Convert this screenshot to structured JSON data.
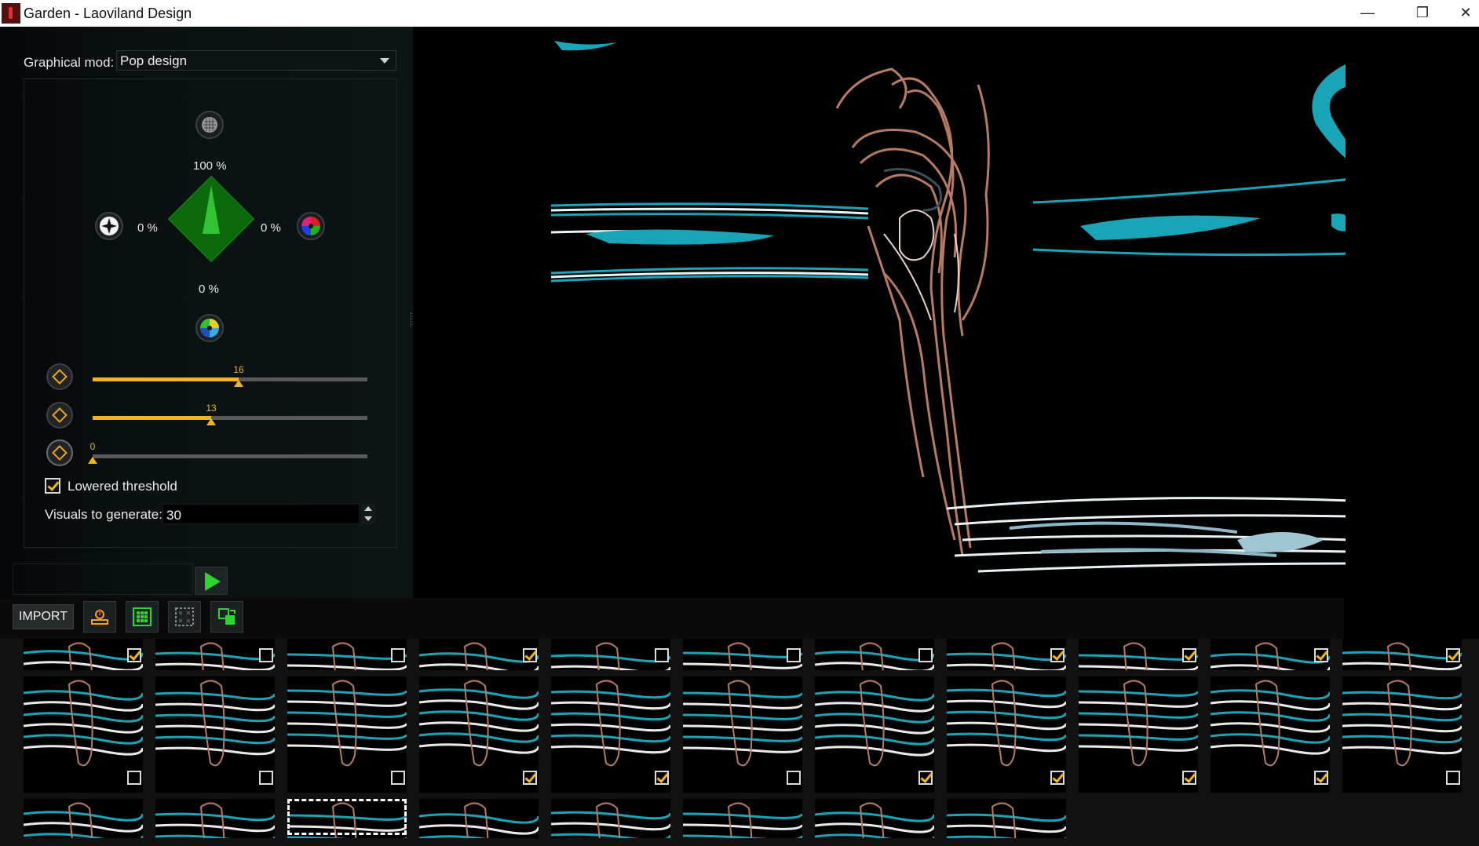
{
  "window": {
    "title": "Garden - Laoviland Design",
    "minimize_glyph": "—",
    "maximize_glyph": "❐",
    "close_glyph": "✕"
  },
  "controls": {
    "graphical_mod_label": "Graphical mod:",
    "graphical_mod_value": "Pop design",
    "top_pct": "100 %",
    "left_pct": "0 %",
    "right_pct": "0 %",
    "bottom_pct": "0 %",
    "icons": {
      "top": "texture-circle-icon",
      "left": "black-white-compass-icon",
      "right": "rgb-color-wheel-icon",
      "bottom": "cmy-color-wheel-icon",
      "slider1": "layers-icon",
      "slider2": "fire-layers-icon",
      "slider3": "contrast-icon"
    },
    "sliders": [
      {
        "value": "16",
        "fraction": 0.53
      },
      {
        "value": "13",
        "fraction": 0.43
      },
      {
        "value": "0",
        "fraction": 0.0
      }
    ],
    "lowered_threshold_label": "Lowered threshold",
    "lowered_threshold_checked": true,
    "visuals_label": "Visuals to generate:",
    "visuals_value": "30"
  },
  "toolbar": {
    "import_label": "IMPORT",
    "buttons": [
      "export-icon",
      "select-all-icon",
      "select-none-icon",
      "swap-icon"
    ]
  },
  "gallery": {
    "rows": [
      [
        true,
        false,
        false,
        true,
        false,
        false,
        false,
        true,
        true,
        true,
        true
      ],
      [
        false,
        false,
        false,
        true,
        true,
        false,
        true,
        true,
        true,
        true,
        false
      ],
      [
        null,
        null,
        null,
        null,
        null,
        null,
        null,
        null
      ]
    ],
    "selected_row3_index": 2
  },
  "colors": {
    "accent": "#f0b61a",
    "teal": "#19a5b8",
    "green": "#2bd52b"
  }
}
